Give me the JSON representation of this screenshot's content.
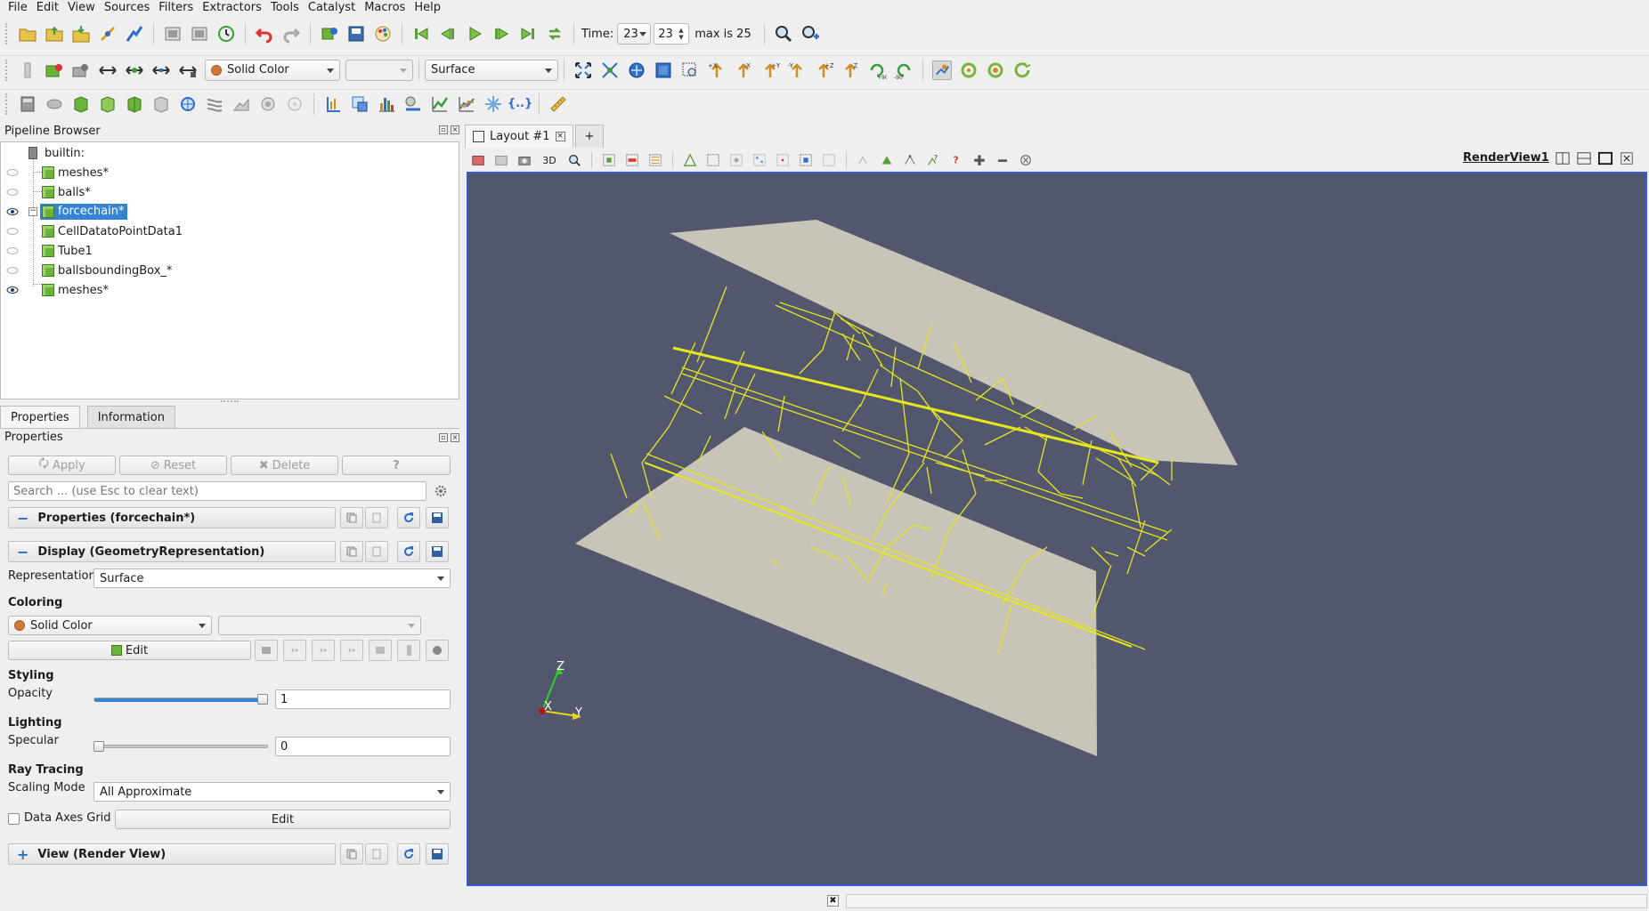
{
  "menu": [
    "File",
    "Edit",
    "View",
    "Sources",
    "Filters",
    "Extractors",
    "Tools",
    "Catalyst",
    "Macros",
    "Help"
  ],
  "time_toolbar": {
    "time_label": "Time:",
    "time_value": "23",
    "timestep_value": "23",
    "max_label": "max is 25"
  },
  "display_toolbar": {
    "coloring": "Solid Color",
    "component": "",
    "representation": "Surface"
  },
  "pipeline_browser": {
    "title": "Pipeline Browser",
    "root": "builtin:",
    "items": [
      {
        "label": "meshes*",
        "visible": false
      },
      {
        "label": "balls*",
        "visible": false
      },
      {
        "label": "forcechain*",
        "visible": true,
        "selected": true
      },
      {
        "label": "CellDatatoPointData1",
        "visible": false
      },
      {
        "label": "Tube1",
        "visible": false
      },
      {
        "label": "ballsboundingBox_*",
        "visible": false
      },
      {
        "label": "meshes*",
        "visible": true
      }
    ]
  },
  "tabs": {
    "properties": "Properties",
    "information": "Information"
  },
  "properties": {
    "title": "Properties",
    "apply": "Apply",
    "reset": "Reset",
    "delete": "Delete",
    "help": "?",
    "search_placeholder": "Search ... (use Esc to clear text)",
    "section_properties": "Properties (forcechain*)",
    "section_display": "Display (GeometryRepresentation)",
    "representation_label": "Representation",
    "representation_value": "Surface",
    "coloring_group": "Coloring",
    "coloring_value": "Solid Color",
    "edit_label": "Edit",
    "styling_group": "Styling",
    "opacity_label": "Opacity",
    "opacity_value": "1",
    "opacity_fraction": 1.0,
    "lighting_group": "Lighting",
    "specular_label": "Specular",
    "specular_value": "0",
    "specular_fraction": 0.0,
    "raytracing_group": "Ray Tracing",
    "scaling_label": "Scaling Mode",
    "scaling_value": "All Approximate",
    "axes_grid_label": "Data Axes Grid",
    "axes_grid_edit": "Edit",
    "section_view": "View (Render View)"
  },
  "layout": {
    "tab_label": "Layout #1",
    "add_tab": "+",
    "view_3d": "3D",
    "render_view_name": "RenderView1"
  },
  "axes": {
    "z": "Z",
    "x": "X",
    "y": "Y"
  },
  "colors": {
    "background": "#52576e",
    "plates": "#c9c4b8",
    "forcechain": "#e6e61e",
    "selection": "#3584d4",
    "active_border": "#3a58d4"
  }
}
